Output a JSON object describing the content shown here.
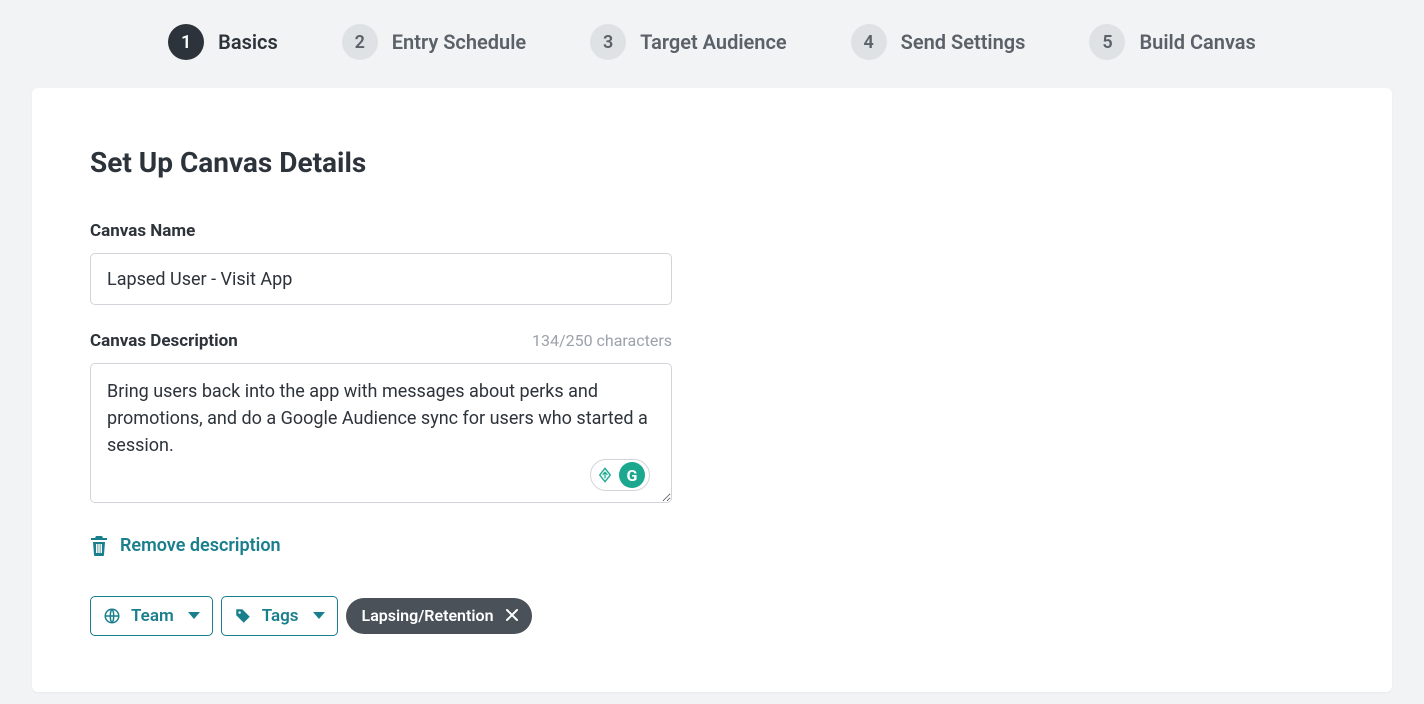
{
  "stepper": {
    "steps": [
      {
        "num": "1",
        "label": "Basics",
        "active": true
      },
      {
        "num": "2",
        "label": "Entry Schedule",
        "active": false
      },
      {
        "num": "3",
        "label": "Target Audience",
        "active": false
      },
      {
        "num": "4",
        "label": "Send Settings",
        "active": false
      },
      {
        "num": "5",
        "label": "Build Canvas",
        "active": false
      }
    ]
  },
  "page": {
    "title": "Set Up Canvas Details"
  },
  "canvas_name": {
    "label": "Canvas Name",
    "value": "Lapsed User - Visit App"
  },
  "canvas_description": {
    "label": "Canvas Description",
    "char_counter": "134/250 characters",
    "value": "Bring users back into the app with messages about perks and promotions, and do a Google Audience sync for users who started a session."
  },
  "remove_description": {
    "label": "Remove description"
  },
  "team_dropdown": {
    "label": "Team"
  },
  "tags_dropdown": {
    "label": "Tags"
  },
  "applied_tags": [
    {
      "label": "Lapsing/Retention"
    }
  ],
  "grammar_widget": {
    "letter": "G"
  }
}
